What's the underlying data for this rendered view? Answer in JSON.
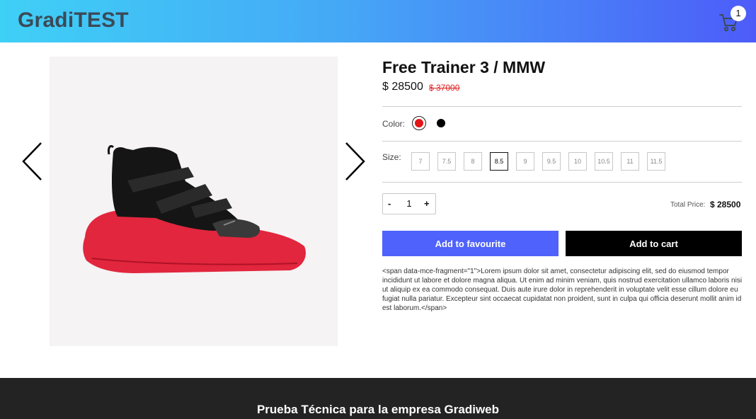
{
  "header": {
    "brand": "GradiTEST",
    "cart_count": "1",
    "cart_icon": "cart-icon"
  },
  "gallery": {
    "prev_icon": "chevron-left-icon",
    "next_icon": "chevron-right-icon",
    "image": "sneaker-product-image"
  },
  "product": {
    "title": "Free Trainer 3 / MMW",
    "price": "$ 28500",
    "old_price": "$ 37000",
    "color_label": "Color:",
    "colors": [
      {
        "name": "red",
        "hex": "#e41515",
        "selected": true
      },
      {
        "name": "black",
        "hex": "#000000",
        "selected": false
      }
    ],
    "size_label": "Size:",
    "sizes": [
      "7",
      "7.5",
      "8",
      "8.5",
      "9",
      "9.5",
      "10",
      "10.5",
      "11",
      "11.5"
    ],
    "selected_size": "8.5",
    "quantity": {
      "minus": "-",
      "value": "1",
      "plus": "+"
    },
    "total_label": "Total Price:",
    "total_value": "$ 28500",
    "fav_button": "Add to favourite",
    "cart_button": "Add to cart",
    "description": "<span data-mce-fragment=\"1\">Lorem ipsum dolor sit amet, consectetur adipiscing elit, sed do eiusmod tempor incididunt ut labore et dolore magna aliqua. Ut enim ad minim veniam, quis nostrud exercitation ullamco laboris nisi ut aliquip ex ea commodo consequat. Duis aute irure dolor in reprehenderit in voluptate velit esse cillum dolore eu fugiat nulla pariatur. Excepteur sint occaecat cupidatat non proident, sunt in culpa qui officia deserunt mollit anim id est laborum.</span>"
  },
  "colors": {
    "accent": "#4f62fb",
    "header_start": "#3fd0f6",
    "header_end": "#4d5cf9",
    "footer": "#232323",
    "sale_red": "#e02020"
  },
  "footer": {
    "text": "Prueba Técnica para la empresa Gradiweb"
  }
}
